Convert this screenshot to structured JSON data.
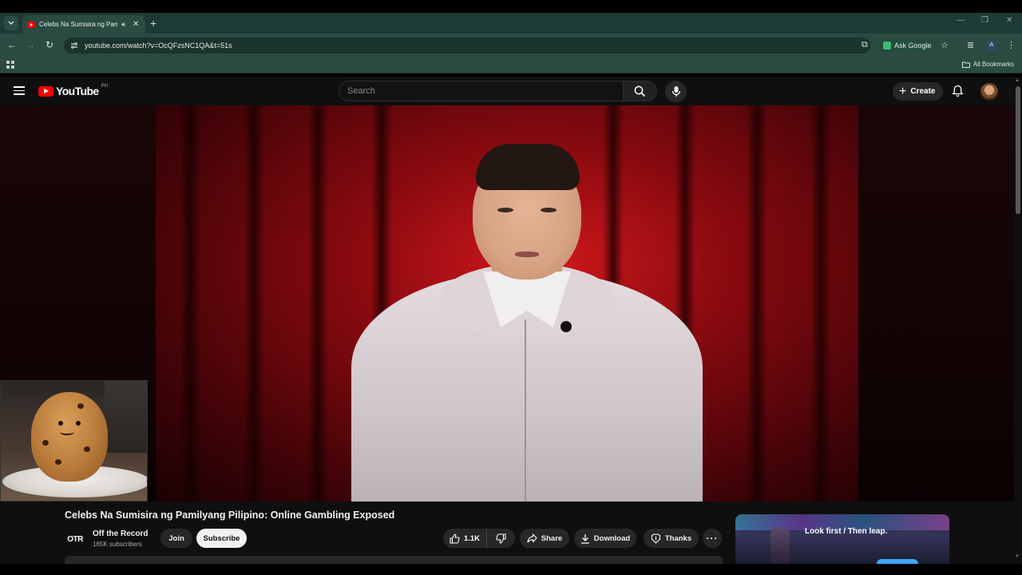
{
  "browser": {
    "tab_title": "Celebs Na Sumisira ng Pam",
    "url": "youtube.com/watch?v=OcQFzsNC1QA&t=51s",
    "ask_google_label": "Ask Google",
    "bookmarks_label": "All Bookmarks"
  },
  "youtube": {
    "logo_text": "YouTube",
    "country_code": "PH",
    "search_placeholder": "Search",
    "create_label": "Create"
  },
  "video": {
    "title": "Celebs Na Sumisira ng Pamilyang Pilipino: Online Gambling Exposed",
    "channel": {
      "avatar_text": "OTR",
      "name": "Off the Record",
      "subscribers": "165K subscribers"
    },
    "join_label": "Join",
    "subscribe_label": "Subscribe",
    "like_count": "1.1K",
    "share_label": "Share",
    "download_label": "Download",
    "thanks_label": "Thanks"
  },
  "ad": {
    "headline": "Look first / Then leap."
  },
  "colors": {
    "browser_chrome": "#2a4a42",
    "youtube_bg": "#0f0f0f",
    "youtube_red": "#ff0000",
    "subscribe_bg": "#f1f1f1"
  }
}
